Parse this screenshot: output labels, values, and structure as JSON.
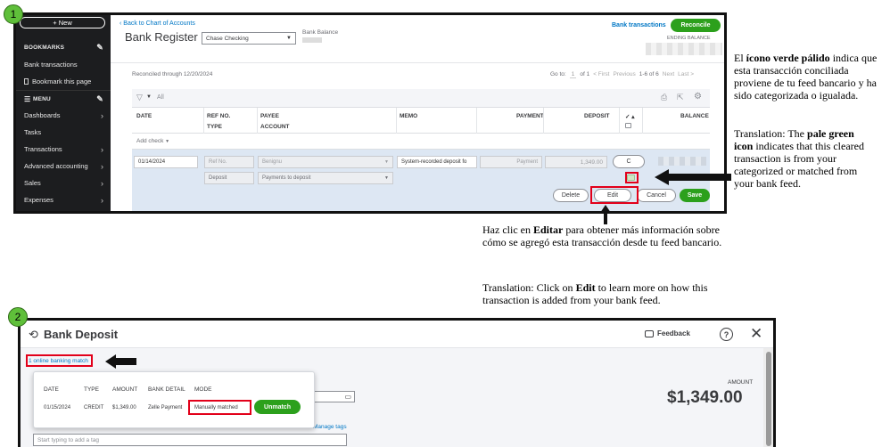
{
  "steps": {
    "one": "1",
    "two": "2"
  },
  "frame1": {
    "sidebar": {
      "new_label": "+ New",
      "bookmarks_label": "BOOKMARKS",
      "bank_transactions": "Bank transactions",
      "bookmark_page": "Bookmark this page",
      "menu_label": "MENU",
      "items": [
        {
          "label": "Dashboards"
        },
        {
          "label": "Tasks"
        },
        {
          "label": "Transactions"
        },
        {
          "label": "Advanced accounting"
        },
        {
          "label": "Sales"
        },
        {
          "label": "Expenses"
        }
      ]
    },
    "header": {
      "back_link": "Back to Chart of Accounts",
      "title": "Bank Register",
      "account_select": "Chase Checking",
      "bank_balance_label": "Bank Balance",
      "bank_transactions_link": "Bank transactions",
      "reconcile_button": "Reconcile",
      "ending_balance_label": "ENDING BALANCE"
    },
    "reconciled_through": "Reconciled through 12/20/2024",
    "pagination": {
      "goto_label": "Go to:",
      "page": "1",
      "of": "of 1",
      "first": "< First",
      "previous": "Previous",
      "range": "1-6 of 6",
      "next": "Next",
      "last": "Last >"
    },
    "filter_label": "All",
    "columns": {
      "date": "DATE",
      "ref_no": "REF NO.",
      "type": "TYPE",
      "payee": "PAYEE",
      "account": "ACCOUNT",
      "memo": "MEMO",
      "payment": "PAYMENT",
      "deposit": "DEPOSIT",
      "check": "✓ ▴",
      "balance": "BALANCE"
    },
    "add_check": "Add check",
    "row": {
      "date": "01/14/2024",
      "ref_placeholder": "Ref No.",
      "payee": "Benignu",
      "memo": "System-recorded deposit fo",
      "payment_placeholder": "Payment",
      "deposit": "1,349.00",
      "status": "C",
      "type": "Deposit",
      "account": "Payments to deposit"
    },
    "actions": {
      "delete": "Delete",
      "edit": "Edit",
      "cancel": "Cancel",
      "save": "Save"
    }
  },
  "annotations": {
    "icon_es_1": "El ",
    "icon_es_bold": "ícono verde pálido",
    "icon_es_2": " indica que esta transacción conciliada proviene de tu feed bancario y ha sido categorizada o igualada.",
    "icon_en_1": "Translation: The ",
    "icon_en_bold": "pale green icon",
    "icon_en_2": " indicates that this cleared transaction is from your categorized or matched from your bank feed.",
    "edit_es_1": "Haz clic en ",
    "edit_es_bold": "Editar",
    "edit_es_2": " para obtener más información sobre cómo se agregó esta transacción desde tu feed bancario.",
    "edit_en_1": "Translation: Click on ",
    "edit_en_bold": "Edit",
    "edit_en_2": " to learn more on how this transaction is added from your bank feed."
  },
  "frame2": {
    "title": "Bank Deposit",
    "feedback": "Feedback",
    "match_link": "1 online banking match",
    "popup": {
      "headers": {
        "date": "DATE",
        "type": "TYPE",
        "amount": "AMOUNT",
        "bank_detail": "BANK DETAIL",
        "mode": "MODE"
      },
      "row": {
        "date": "01/15/2024",
        "type": "CREDIT",
        "amount": "$1,349.00",
        "bank_detail": "Zelle Payment",
        "mode": "Manually matched"
      },
      "unmatch": "Unmatch"
    },
    "manage_tags": "Manage tags",
    "tag_placeholder": "Start typing to add a tag",
    "amount_label": "AMOUNT",
    "amount_value": "$1,349.00"
  },
  "colors": {
    "green": "#2ca01c",
    "red": "#e2001a",
    "link": "#0077c5",
    "sidebar": "#1c1d1f"
  }
}
